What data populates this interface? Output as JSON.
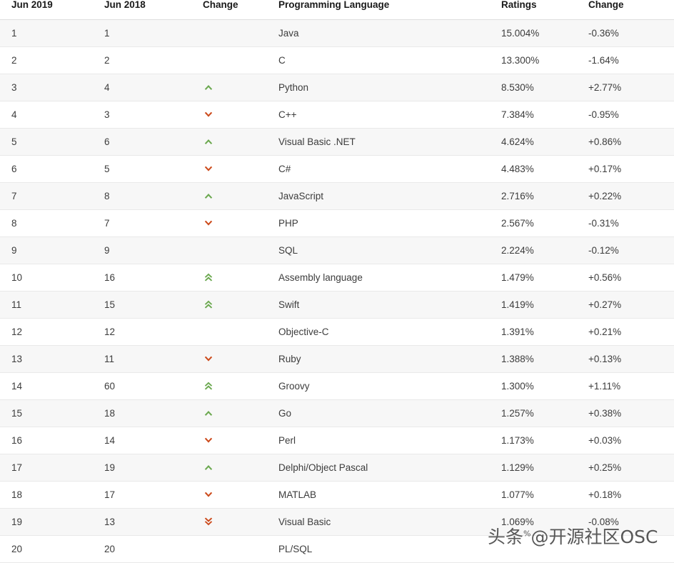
{
  "table": {
    "columns": [
      {
        "key": "rank_new",
        "label": "Jun 2019",
        "name": "column-header-jun-2019"
      },
      {
        "key": "rank_old",
        "label": "Jun 2018",
        "name": "column-header-jun-2018"
      },
      {
        "key": "change",
        "label": "Change",
        "name": "column-header-change-arrow"
      },
      {
        "key": "language",
        "label": "Programming Language",
        "name": "column-header-programming-language"
      },
      {
        "key": "ratings",
        "label": "Ratings",
        "name": "column-header-ratings"
      },
      {
        "key": "delta",
        "label": "Change",
        "name": "column-header-change-delta"
      }
    ],
    "rows": [
      {
        "rank_new": "1",
        "rank_old": "1",
        "change": "none",
        "language": "Java",
        "ratings": "15.004%",
        "delta": "-0.36%"
      },
      {
        "rank_new": "2",
        "rank_old": "2",
        "change": "none",
        "language": "C",
        "ratings": "13.300%",
        "delta": "-1.64%"
      },
      {
        "rank_new": "3",
        "rank_old": "4",
        "change": "up",
        "language": "Python",
        "ratings": "8.530%",
        "delta": "+2.77%"
      },
      {
        "rank_new": "4",
        "rank_old": "3",
        "change": "down",
        "language": "C++",
        "ratings": "7.384%",
        "delta": "-0.95%"
      },
      {
        "rank_new": "5",
        "rank_old": "6",
        "change": "up",
        "language": "Visual Basic .NET",
        "ratings": "4.624%",
        "delta": "+0.86%"
      },
      {
        "rank_new": "6",
        "rank_old": "5",
        "change": "down",
        "language": "C#",
        "ratings": "4.483%",
        "delta": "+0.17%"
      },
      {
        "rank_new": "7",
        "rank_old": "8",
        "change": "up",
        "language": "JavaScript",
        "ratings": "2.716%",
        "delta": "+0.22%"
      },
      {
        "rank_new": "8",
        "rank_old": "7",
        "change": "down",
        "language": "PHP",
        "ratings": "2.567%",
        "delta": "-0.31%"
      },
      {
        "rank_new": "9",
        "rank_old": "9",
        "change": "none",
        "language": "SQL",
        "ratings": "2.224%",
        "delta": "-0.12%"
      },
      {
        "rank_new": "10",
        "rank_old": "16",
        "change": "up-double",
        "language": "Assembly language",
        "ratings": "1.479%",
        "delta": "+0.56%"
      },
      {
        "rank_new": "11",
        "rank_old": "15",
        "change": "up-double",
        "language": "Swift",
        "ratings": "1.419%",
        "delta": "+0.27%"
      },
      {
        "rank_new": "12",
        "rank_old": "12",
        "change": "none",
        "language": "Objective-C",
        "ratings": "1.391%",
        "delta": "+0.21%"
      },
      {
        "rank_new": "13",
        "rank_old": "11",
        "change": "down",
        "language": "Ruby",
        "ratings": "1.388%",
        "delta": "+0.13%"
      },
      {
        "rank_new": "14",
        "rank_old": "60",
        "change": "up-double",
        "language": "Groovy",
        "ratings": "1.300%",
        "delta": "+1.11%"
      },
      {
        "rank_new": "15",
        "rank_old": "18",
        "change": "up",
        "language": "Go",
        "ratings": "1.257%",
        "delta": "+0.38%"
      },
      {
        "rank_new": "16",
        "rank_old": "14",
        "change": "down",
        "language": "Perl",
        "ratings": "1.173%",
        "delta": "+0.03%"
      },
      {
        "rank_new": "17",
        "rank_old": "19",
        "change": "up",
        "language": "Delphi/Object Pascal",
        "ratings": "1.129%",
        "delta": "+0.25%"
      },
      {
        "rank_new": "18",
        "rank_old": "17",
        "change": "down",
        "language": "MATLAB",
        "ratings": "1.077%",
        "delta": "+0.18%"
      },
      {
        "rank_new": "19",
        "rank_old": "13",
        "change": "down-double",
        "language": "Visual Basic",
        "ratings": "1.069%",
        "delta": "-0.08%"
      },
      {
        "rank_new": "20",
        "rank_old": "20",
        "change": "none",
        "language": "PL/SQL",
        "ratings": "",
        "delta": ""
      }
    ]
  },
  "icons": {
    "up": "chevron-up-icon",
    "down": "chevron-down-icon",
    "up-double": "chevron-double-up-icon",
    "down-double": "chevron-double-down-icon",
    "none": "no-change-icon"
  },
  "colors": {
    "up": "#6ba84f",
    "down": "#cc4a1b",
    "row_odd": "#f7f7f7",
    "row_even": "#ffffff",
    "border": "#e9e9e9",
    "text": "#3c3c3c",
    "header_text": "#1a1a1a"
  },
  "watermark": {
    "prefix": "头条",
    "superscript": "%",
    "suffix": "@开源社区OSC"
  }
}
